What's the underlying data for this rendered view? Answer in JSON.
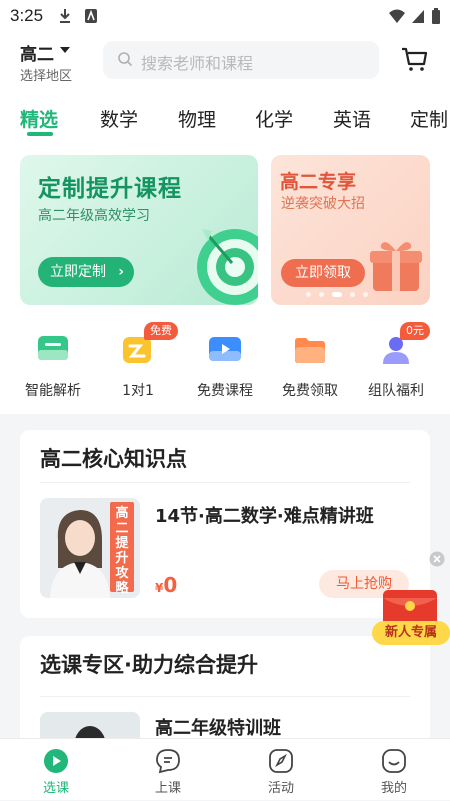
{
  "status_bar": {
    "time": "3:25"
  },
  "header": {
    "grade": "高二",
    "region": "选择地区",
    "search_placeholder": "搜索老师和课程"
  },
  "tabs": [
    {
      "label": "精选",
      "active": true
    },
    {
      "label": "数学",
      "active": false
    },
    {
      "label": "物理",
      "active": false
    },
    {
      "label": "化学",
      "active": false
    },
    {
      "label": "英语",
      "active": false
    },
    {
      "label": "定制",
      "active": false
    }
  ],
  "banner_main": {
    "title": "定制提升课程",
    "subtitle": "高二年级高效学习",
    "button": "立即定制"
  },
  "banner_side": {
    "title": "高二专享",
    "subtitle": "逆袭突破大招",
    "button": "立即领取"
  },
  "quick_entries": [
    {
      "label": "智能解析",
      "badge": ""
    },
    {
      "label": "1对1",
      "badge": "免费"
    },
    {
      "label": "免费课程",
      "badge": ""
    },
    {
      "label": "免费领取",
      "badge": ""
    },
    {
      "label": "组队福利",
      "badge": "0元"
    }
  ],
  "section_core": {
    "title": "高二核心知识点",
    "course": {
      "thumb_tag": "高二提升攻略",
      "title": "14节·高二数学·难点精讲班",
      "price_symbol": "¥",
      "price": "0",
      "button": "马上抢购"
    }
  },
  "section_select": {
    "title": "选课专区·助力综合提升",
    "course": {
      "title": "高二年级特训班"
    }
  },
  "promo": {
    "label": "新人专属"
  },
  "bottom_nav": [
    {
      "label": "选课",
      "active": true
    },
    {
      "label": "上课",
      "active": false
    },
    {
      "label": "活动",
      "active": false
    },
    {
      "label": "我的",
      "active": false
    }
  ],
  "colors": {
    "accent": "#21b77a",
    "promo": "#f4603f"
  }
}
